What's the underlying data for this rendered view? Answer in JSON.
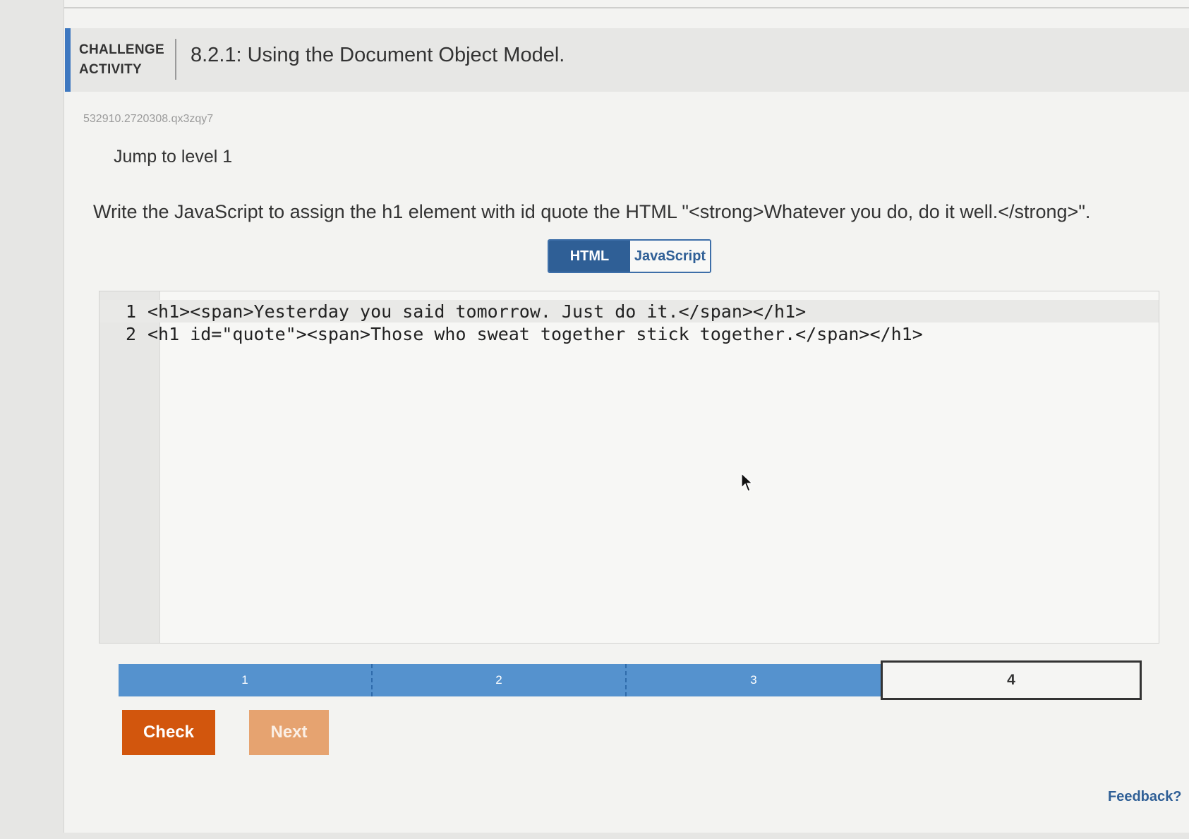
{
  "header": {
    "activity_type": "CHALLENGE ACTIVITY",
    "title": "8.2.1: Using the Document Object Model."
  },
  "activity_id": "532910.2720308.qx3zqy7",
  "jump_to_level": "Jump to level 1",
  "instruction": "Write the JavaScript to assign the h1 element with id quote the HTML \"<strong>Whatever you do, do it well.</strong>\".",
  "tabs": [
    {
      "label": "HTML",
      "active": true
    },
    {
      "label": "JavaScript",
      "active": false
    }
  ],
  "editor": {
    "lines": [
      {
        "number": "1",
        "code": "<h1><span>Yesterday you said tomorrow. Just do it.</span></h1>"
      },
      {
        "number": "2",
        "code": "<h1 id=\"quote\"><span>Those who sweat together stick together.</span></h1>"
      }
    ]
  },
  "levels": [
    {
      "label": "1",
      "status": "done"
    },
    {
      "label": "2",
      "status": "done"
    },
    {
      "label": "3",
      "status": "done"
    },
    {
      "label": "4",
      "status": "current"
    }
  ],
  "buttons": {
    "check": "Check",
    "next": "Next"
  },
  "feedback_link": "Feedback?"
}
